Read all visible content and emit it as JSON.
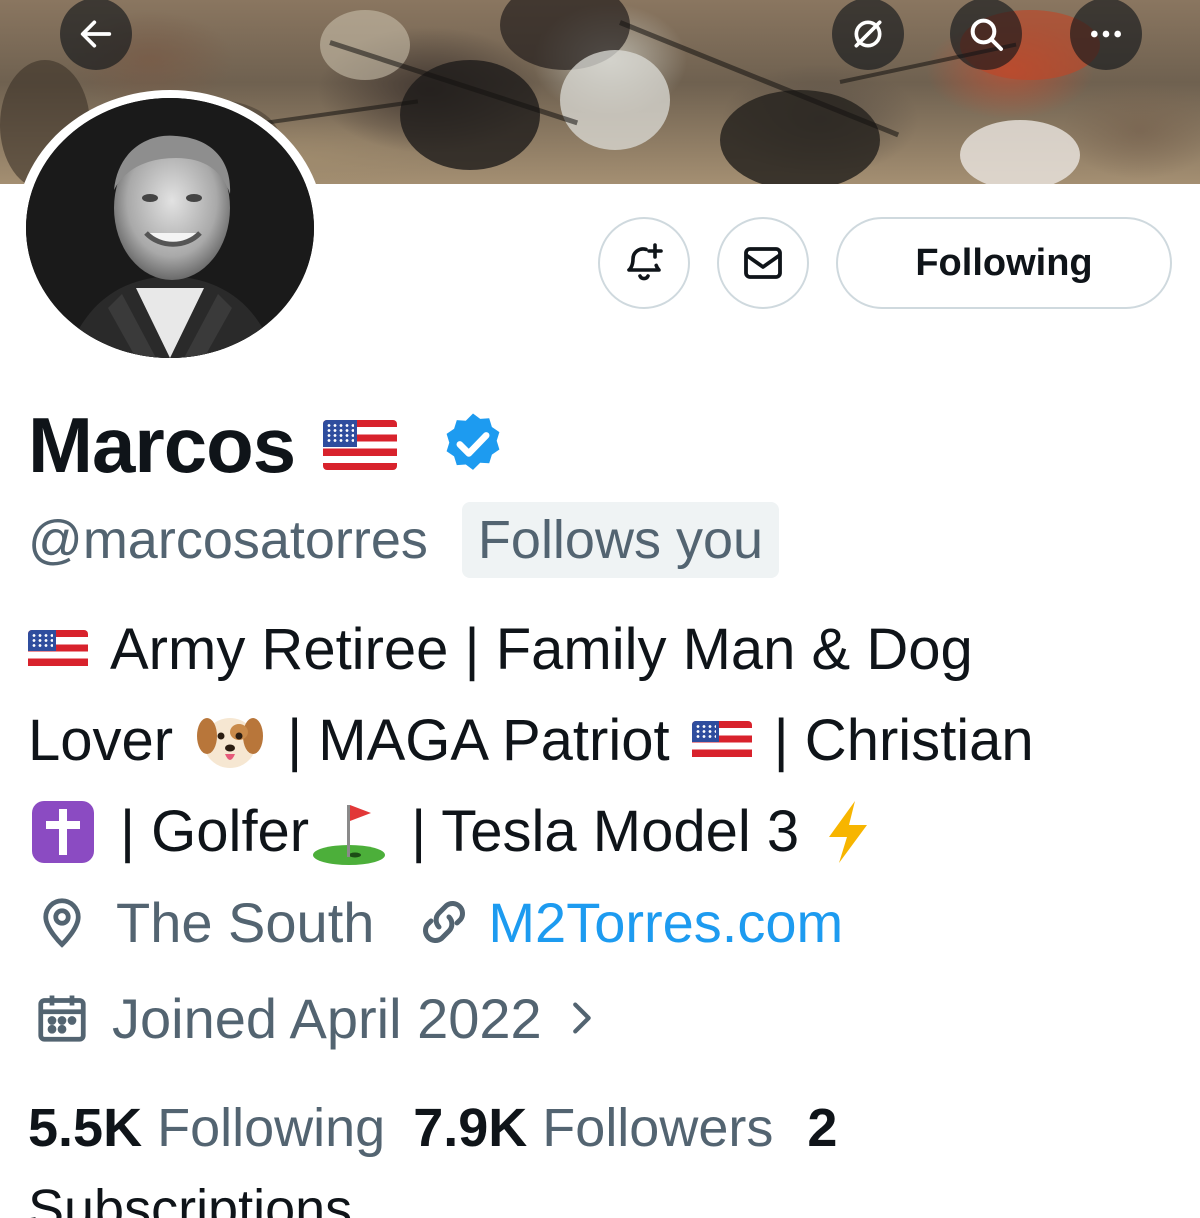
{
  "header": {
    "back_icon": "arrow-left-icon",
    "actions": [
      "translate-icon",
      "search-icon",
      "more-icon"
    ]
  },
  "profile": {
    "display_name": "Marcos",
    "name_emoji": "us-flag",
    "verified_color": "#1d9bf0",
    "handle": "@marcosatorres",
    "follows_you": "Follows you",
    "bio": {
      "line1": "Army Retiree | Family Man & Dog",
      "line2a": "Lover",
      "line2b": "| MAGA Patriot",
      "line2c": "| Christian",
      "line3a": "| Golfer",
      "line3b": "| Tesla Model 3"
    },
    "location": "The South",
    "website": "M2Torres.com",
    "joined": "Joined April 2022",
    "following_count": "5.5K",
    "following_label": "Following",
    "followers_count": "7.9K",
    "followers_label": "Followers",
    "subscriptions_count": "2",
    "subscriptions_label": "Subscriptions"
  },
  "buttons": {
    "notify_icon": "bell-plus-icon",
    "message_icon": "envelope-icon",
    "following_label": "Following"
  },
  "colors": {
    "accent": "#1d9bf0",
    "secondary_text": "#536471",
    "primary_text": "#0f1419",
    "border": "#cfd9de"
  }
}
